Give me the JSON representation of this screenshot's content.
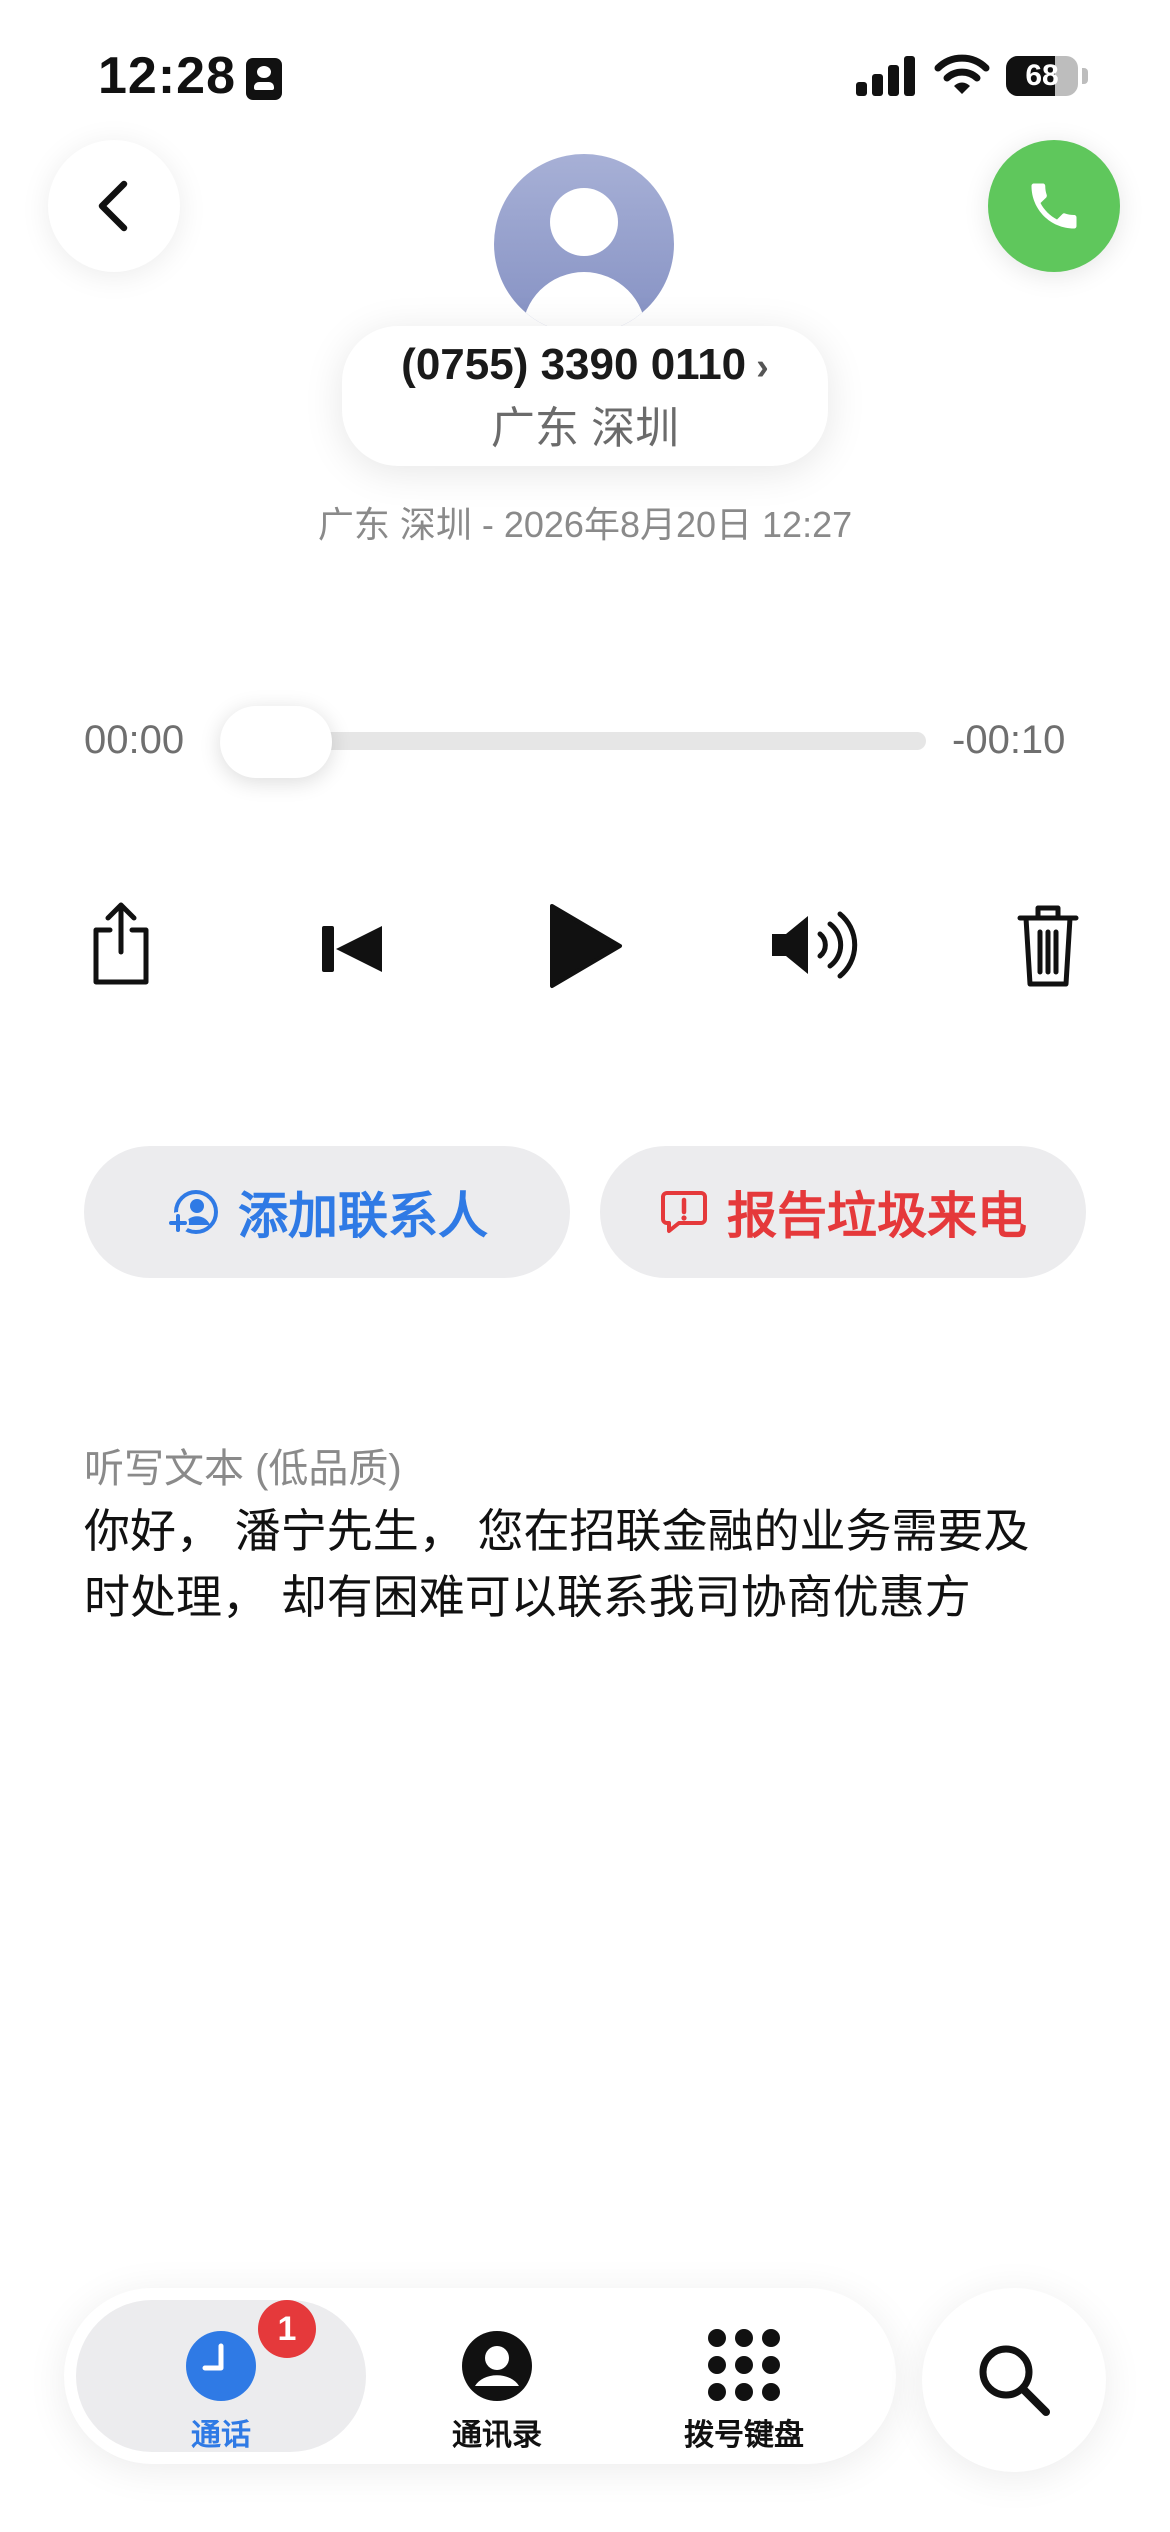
{
  "status_bar": {
    "time": "12:28",
    "battery": "68",
    "battery_level": 0.68
  },
  "icons": {
    "back": "chevron-left-icon",
    "call": "phone-icon",
    "share": "share-icon",
    "skip_back": "skip-back-icon",
    "play": "play-icon",
    "volume": "speaker-icon",
    "delete": "trash-icon",
    "add_contact": "add-contact-icon",
    "report": "report-icon",
    "calls_tab": "clock-icon",
    "contacts_tab": "person-icon",
    "keypad_tab": "keypad-icon",
    "search": "search-icon"
  },
  "contact": {
    "phone_number": "(0755) 3390 0110",
    "chevron": "›",
    "location": "广东 深圳"
  },
  "call_meta": "广东 深圳 - 2026年8月20日 12:27",
  "player": {
    "elapsed": "00:00",
    "remaining": "-00:10",
    "progress": 0
  },
  "actions": {
    "add_contact": "添加联系人",
    "report_spam": "报告垃圾来电"
  },
  "transcript": {
    "title": "听写文本 (低品质)",
    "text": "你好， 潘宁先生， 您在招联金融的业务需要及时处理， 却有困难可以联系我司协商优惠方"
  },
  "tabs": {
    "calls": "通话",
    "calls_badge": "1",
    "contacts": "通讯录",
    "keypad": "拨号键盘"
  },
  "colors": {
    "accent_blue": "#2f7ae5",
    "danger_red": "#e5393b",
    "call_green": "#5fc75c"
  }
}
